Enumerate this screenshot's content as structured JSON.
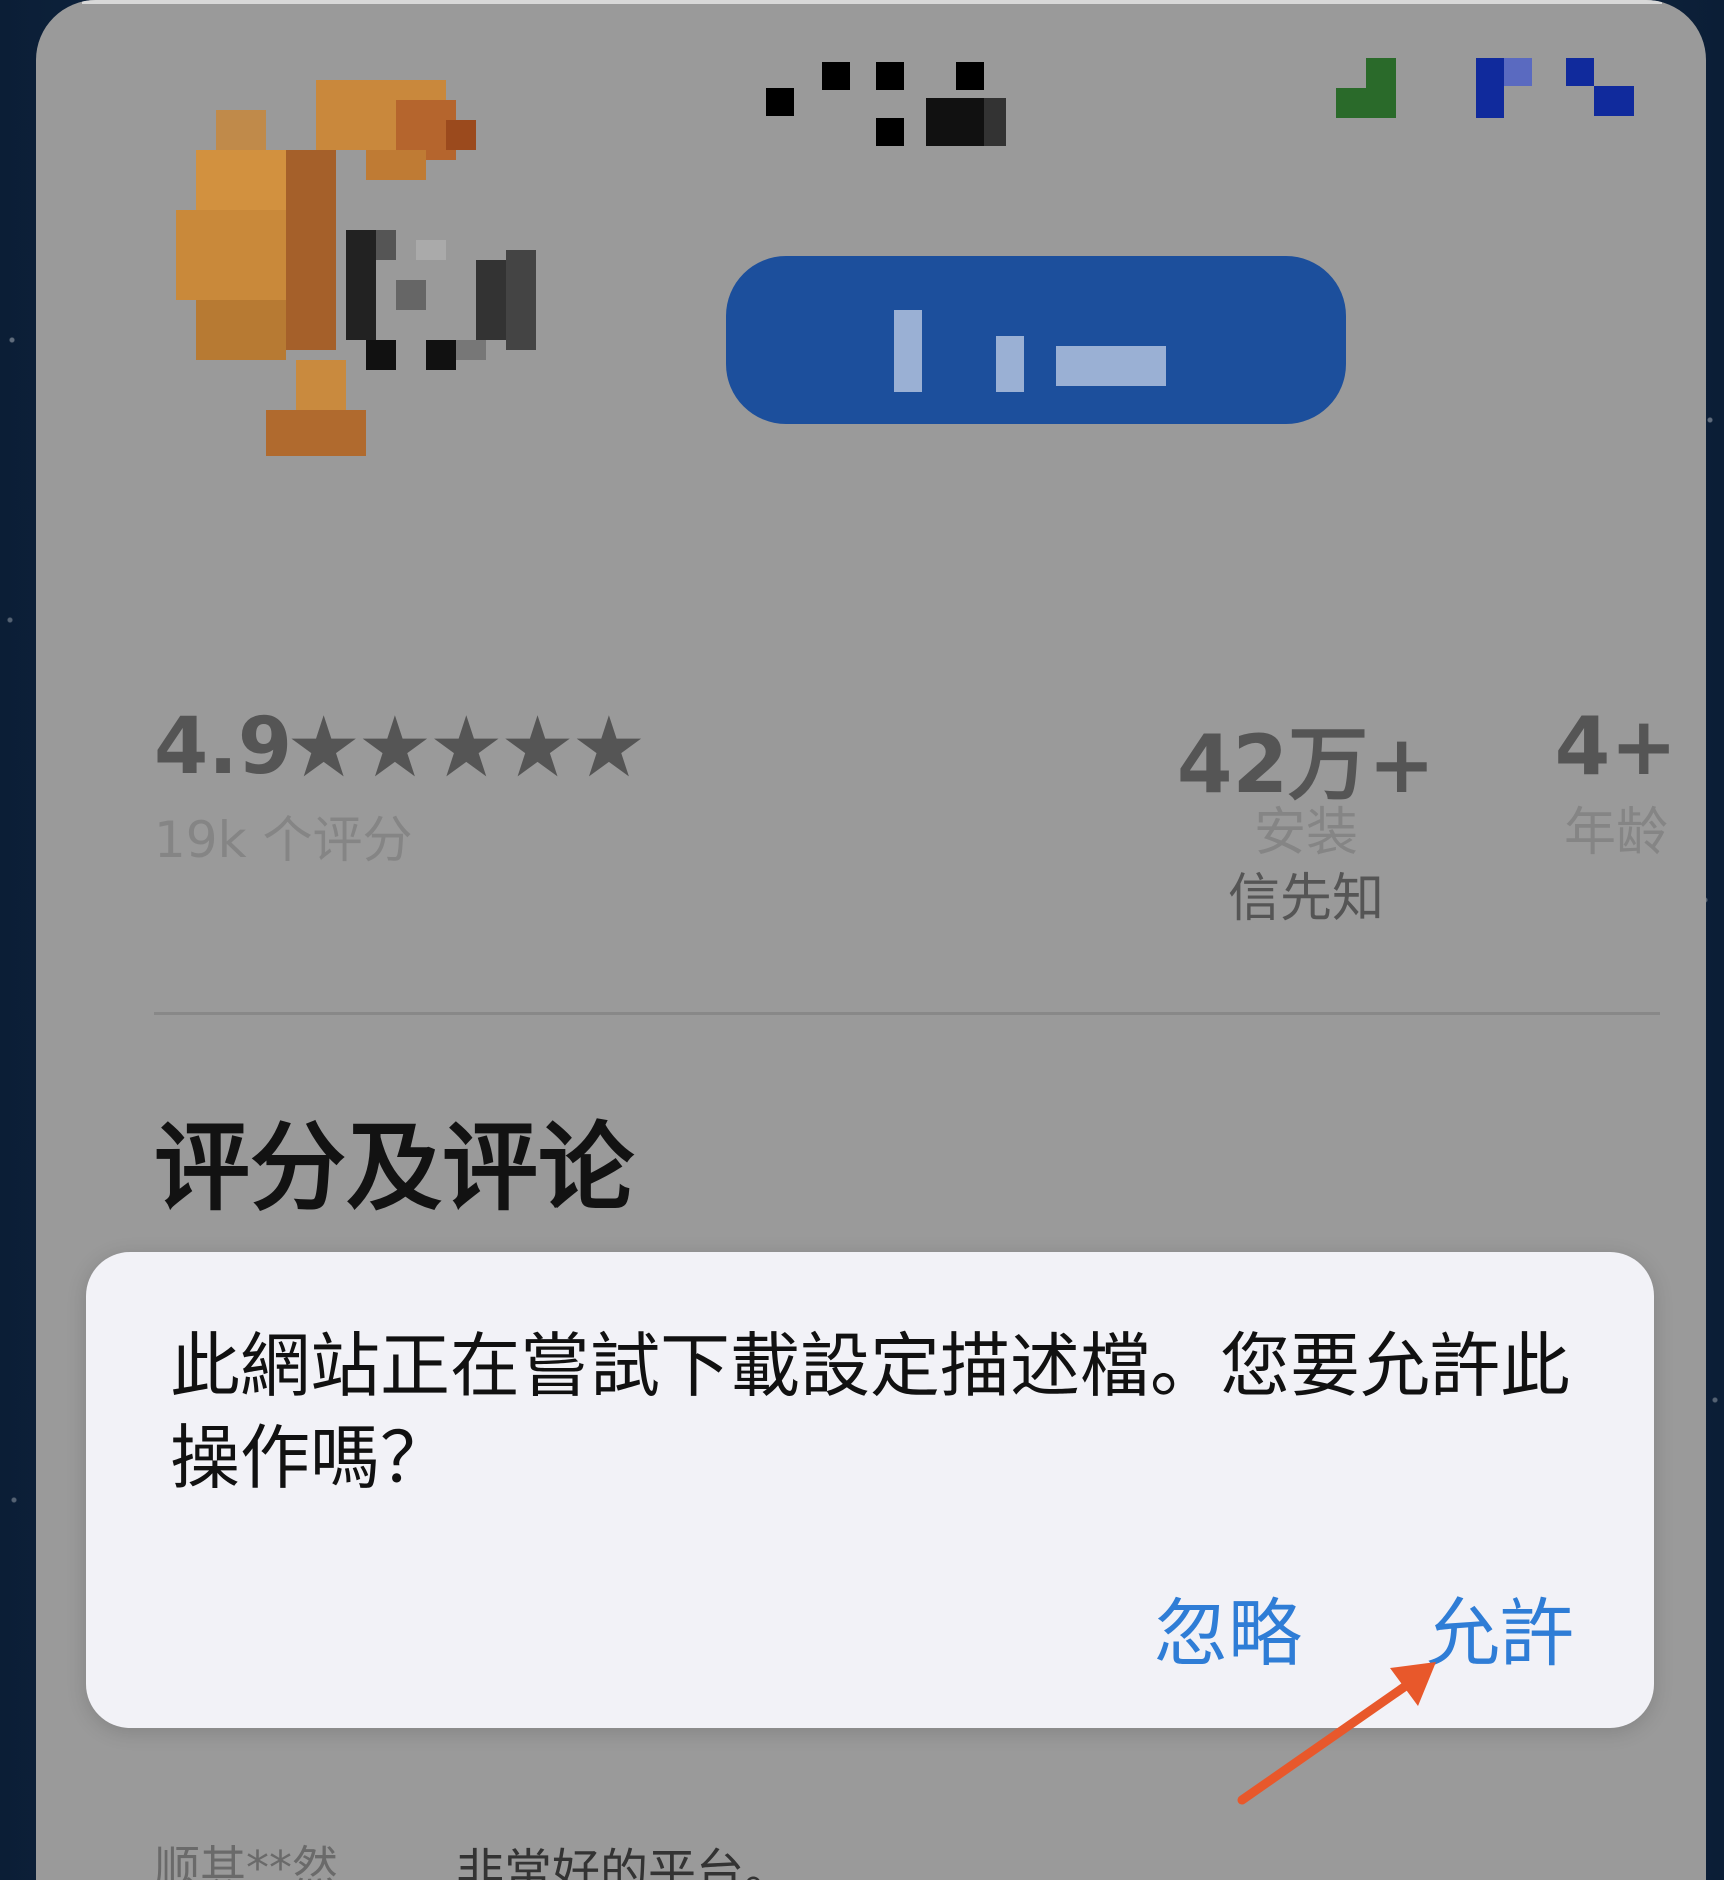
{
  "app_stats": {
    "rating_value": "4.9",
    "stars": "★★★★★",
    "rating_count": "19k 个评分",
    "installs_value": "42万+",
    "installs_label": "安装",
    "installs_sub": "信先知",
    "age_value": "4+",
    "age_label": "年龄"
  },
  "section": {
    "title": "评分及评论"
  },
  "review": {
    "author": "顺其**然",
    "text": "非常好的平台。"
  },
  "dialog": {
    "message": "此網站正在嘗試下載設定描述檔。您要允許此操作嗎？",
    "ignore_label": "忽略",
    "allow_label": "允許"
  },
  "colors": {
    "dialog_button": "#2f7dd6",
    "arrow": "#e8582b",
    "get_button": "#1c4f9c"
  },
  "icons": {
    "app_icon": "pixelated-app-icon",
    "annotation": "arrow-icon"
  }
}
